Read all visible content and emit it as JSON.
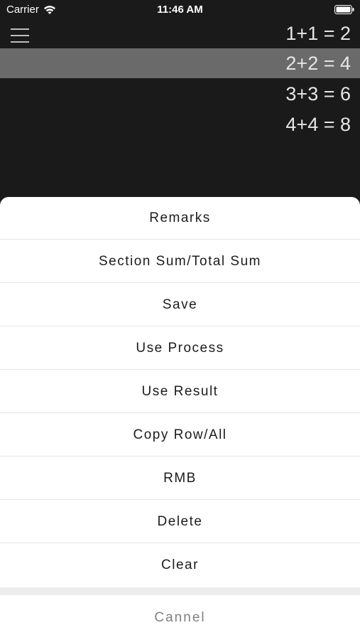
{
  "status_bar": {
    "carrier": "Carrier",
    "time": "11:46 AM"
  },
  "calculator": {
    "menu_icon": "hamburger-menu-icon",
    "rows": [
      {
        "expression": "1+1 = 2",
        "selected": false
      },
      {
        "expression": "2+2 = 4",
        "selected": true
      },
      {
        "expression": "3+3 = 6",
        "selected": false
      },
      {
        "expression": "4+4 = 8",
        "selected": false
      }
    ]
  },
  "action_sheet": {
    "items": [
      "Remarks",
      "Section Sum/Total Sum",
      "Save",
      "Use Process",
      "Use Result",
      "Copy Row/All",
      "RMB",
      "Delete",
      "Clear"
    ],
    "cancel_label": "Cannel"
  },
  "colors": {
    "background": "#1a1a1a",
    "selected_row": "#6a6a6a",
    "sheet_background": "#ffffff",
    "cancel_text": "#808080"
  }
}
